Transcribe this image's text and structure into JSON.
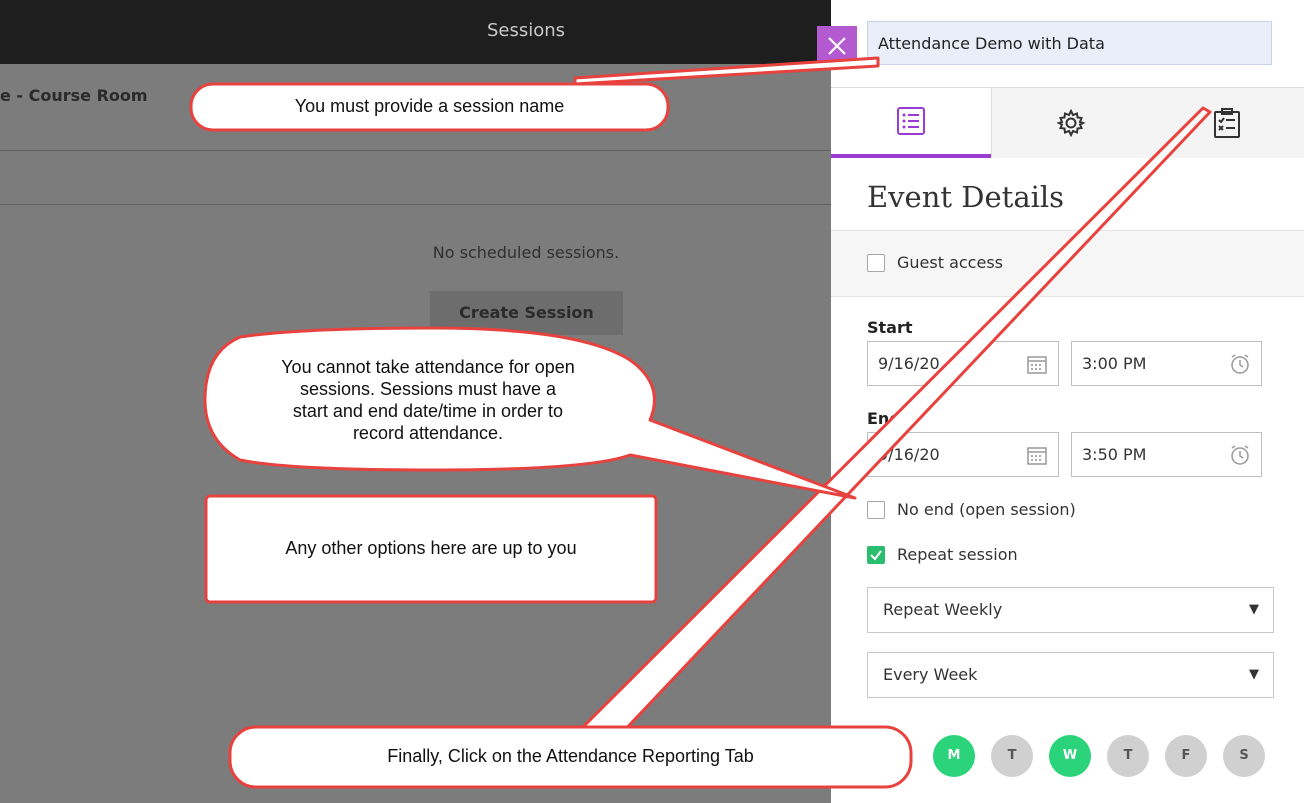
{
  "background": {
    "title": "Sessions",
    "course_name": "e - Course Room",
    "empty_message": "No scheduled sessions.",
    "create_button": "Create Session"
  },
  "panel": {
    "session_name_value": "Attendance Demo with Data",
    "tabs": [
      {
        "icon": "event-details-list-icon",
        "active": true
      },
      {
        "icon": "gear-icon",
        "active": false
      },
      {
        "icon": "attendance-clipboard-icon",
        "active": false
      }
    ],
    "section_title": "Event Details",
    "guest_access_label": "Guest access",
    "guest_access_checked": false,
    "start_label": "Start",
    "start_date": "9/16/20",
    "start_time": "3:00 PM",
    "end_label": "End",
    "end_date": "9/16/20",
    "end_time": "3:50 PM",
    "no_end_label": "No end (open session)",
    "no_end_checked": false,
    "repeat_label": "Repeat session",
    "repeat_checked": true,
    "repeat_frequency": "Repeat Weekly",
    "repeat_interval": "Every Week",
    "days": [
      {
        "label": "M",
        "selected": true
      },
      {
        "label": "T",
        "selected": false
      },
      {
        "label": "W",
        "selected": true
      },
      {
        "label": "T",
        "selected": false
      },
      {
        "label": "F",
        "selected": false
      },
      {
        "label": "S",
        "selected": false
      }
    ]
  },
  "callouts": {
    "session_name": "You must provide a session name",
    "open_sessions_1": "You cannot take attendance for open",
    "open_sessions_2": "sessions.  Sessions must have a",
    "open_sessions_3": "start and end date/time in order to",
    "open_sessions_4": "record attendance.",
    "other_options": "Any other options here are up to you",
    "attendance_tab": "Finally, Click on the Attendance Reporting Tab"
  },
  "colors": {
    "accent_purple": "#9b3bd1",
    "close_button": "#b45ad0",
    "day_selected": "#2bd47a",
    "callout_border": "#e8423f"
  }
}
